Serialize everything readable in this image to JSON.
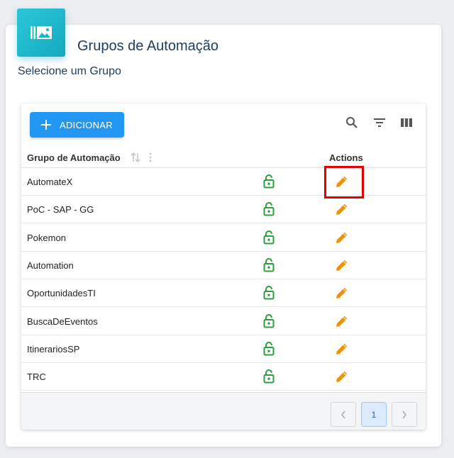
{
  "header": {
    "title": "Grupos de Automação",
    "subtitle": "Selecione um Grupo",
    "icon": "image-icon"
  },
  "toolbar": {
    "add_label": "ADICIONAR",
    "add_color": "#2196f3",
    "tools": [
      "search-icon",
      "filter-icon",
      "columns-icon"
    ]
  },
  "table": {
    "columns": [
      "Grupo de Automação",
      "Actions"
    ],
    "rows": [
      {
        "name": "AutomateX"
      },
      {
        "name": "PoC - SAP - GG"
      },
      {
        "name": "Pokemon"
      },
      {
        "name": "Automation"
      },
      {
        "name": "OportunidadesTI"
      },
      {
        "name": "BuscaDeEventos"
      },
      {
        "name": "ItinerariosSP"
      },
      {
        "name": "TRC"
      }
    ],
    "lock_color": "#2e9e3e",
    "edit_color": "#f39200"
  },
  "pagination": {
    "current_page": "1"
  }
}
